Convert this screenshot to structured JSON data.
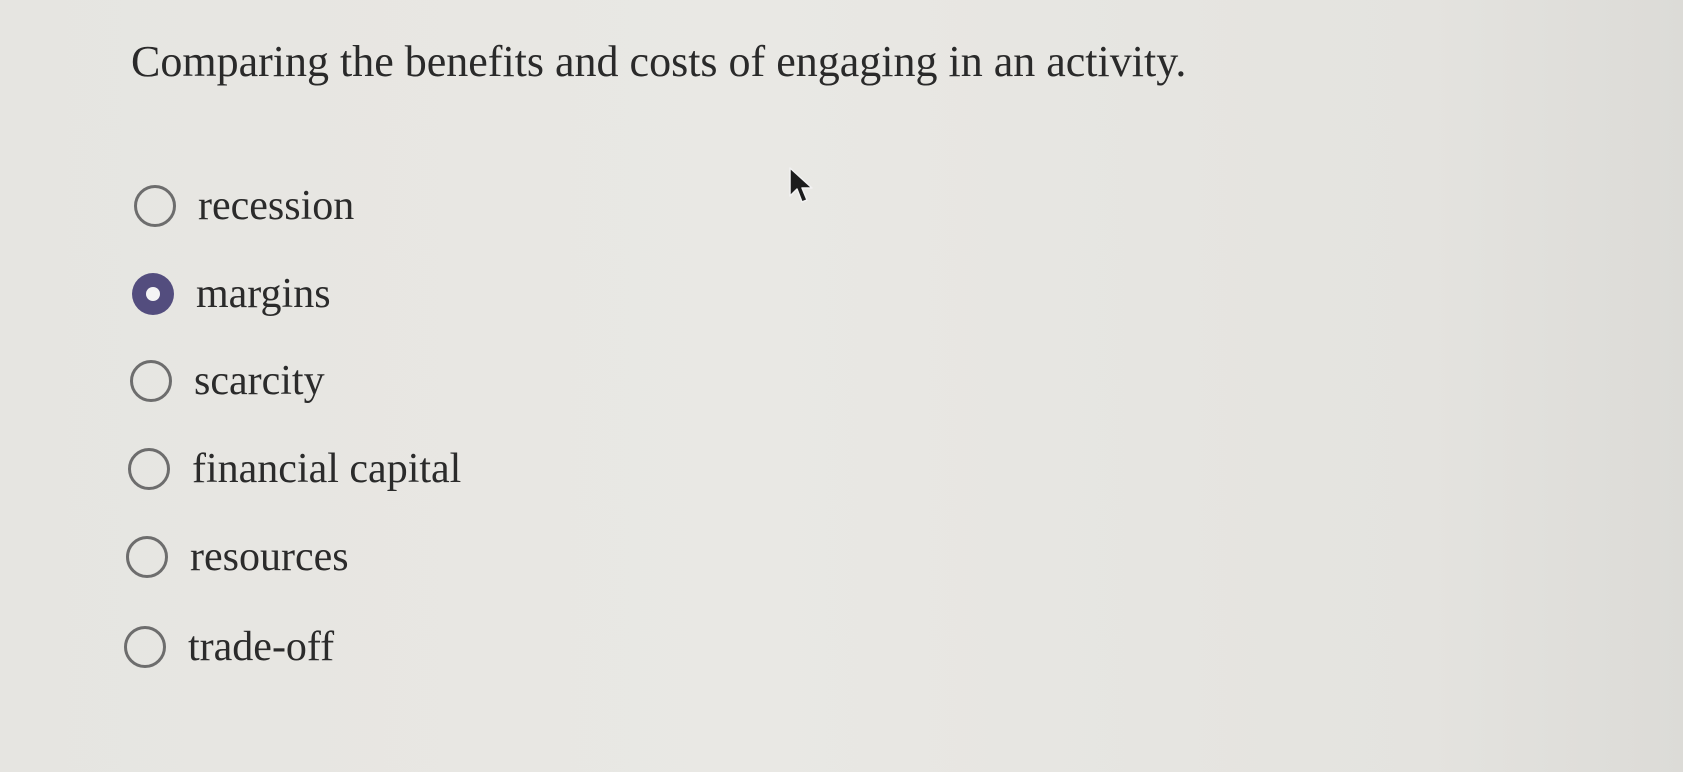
{
  "question": {
    "text": "Comparing the benefits and costs of engaging in an activity."
  },
  "options": [
    {
      "label": "recession",
      "selected": false
    },
    {
      "label": "margins",
      "selected": true
    },
    {
      "label": "scarcity",
      "selected": false
    },
    {
      "label": "financial capital",
      "selected": false
    },
    {
      "label": "resources",
      "selected": false
    },
    {
      "label": "trade-off",
      "selected": false
    }
  ],
  "cursor": {
    "icon": "mouse-pointer-icon"
  },
  "colors": {
    "selected_radio": "#534d7e",
    "radio_border": "#6d6d6d",
    "text": "#2b2b2b",
    "background": "#e6e5e1"
  }
}
